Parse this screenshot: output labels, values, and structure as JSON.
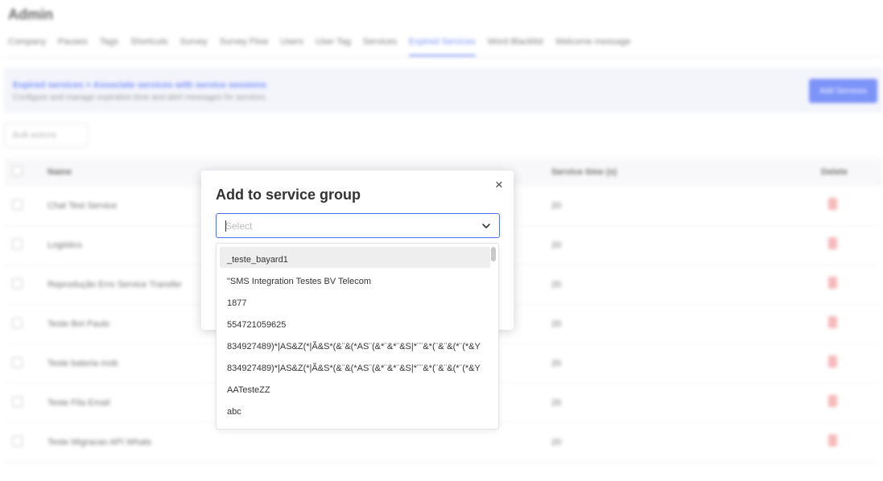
{
  "page": {
    "title": "Admin"
  },
  "tabs": [
    "Company",
    "Pauses",
    "Tags",
    "Shortcuts",
    "Survey",
    "Survey Flow",
    "Users",
    "User Tag",
    "Services",
    "Expired Services",
    "Word Blacklist",
    "Welcome message"
  ],
  "active_tab": "Expired Services",
  "banner": {
    "title": "Expired services > Associate services with service sessions",
    "subtitle": "Configure and manage expiration time and alert messages for services",
    "button_label": "Add Services"
  },
  "filter": {
    "label": "Bulk actions"
  },
  "table": {
    "headers": {
      "name": "Name",
      "time": "Service time (s)",
      "delete": "Delete"
    },
    "rows": [
      {
        "name": "Chat Test Service",
        "time": "20"
      },
      {
        "name": "Logistics",
        "time": "20"
      },
      {
        "name": "Reprodução Erro Service Transfer",
        "time": "20"
      },
      {
        "name": "Teste Bot Paulo",
        "time": "20"
      },
      {
        "name": "Teste bateria mob",
        "time": "20"
      },
      {
        "name": "Teste Fila Email",
        "time": "20"
      },
      {
        "name": "Teste Migracao API Whats",
        "time": "20"
      }
    ]
  },
  "modal": {
    "title": "Add to service group",
    "close_glyph": "×",
    "select_placeholder": "Select",
    "options": [
      "_teste_bayard1",
      "\"SMS Integration Testes BV Telecom",
      "1877",
      "554721059625",
      "834927489)*|AS&Z(*|Ã&S*(&¨&(*AS¨(&*¨&*¨&S|*¨¨&*(¨&¨&(*¨(*&Y",
      "834927489)*|AS&Z(*|Ã&S*(&¨&(*AS¨(&*¨&*¨&S|*¨¨&*(¨&¨&(*¨(*&Y",
      "AATesteZZ",
      "abc"
    ],
    "highlighted_index": 0
  },
  "colors": {
    "accent": "#4f6ef7",
    "delete": "#f4a3a3"
  }
}
